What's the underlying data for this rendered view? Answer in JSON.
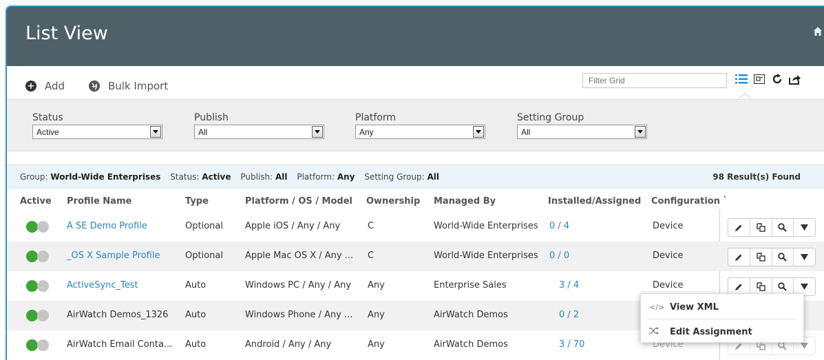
{
  "header": {
    "title": "List View",
    "home_icon": "home-icon"
  },
  "toolbar": {
    "add_label": "Add",
    "bulk_import_label": "Bulk Import",
    "filter_placeholder": "Filter Grid",
    "icons": [
      "list-view-icon",
      "card-view-icon",
      "refresh-icon",
      "export-icon"
    ]
  },
  "filters": {
    "status": {
      "label": "Status",
      "value": "Active"
    },
    "publish": {
      "label": "Publish",
      "value": "All"
    },
    "platform": {
      "label": "Platform",
      "value": "Any"
    },
    "setting_group": {
      "label": "Setting Group",
      "value": "All"
    }
  },
  "summary": {
    "group_label": "Group:",
    "group_value": "World-Wide Enterprises",
    "status_label": "Status:",
    "status_value": "Active",
    "publish_label": "Publish:",
    "publish_value": "All",
    "platform_label": "Platform:",
    "platform_value": "Any",
    "setting_group_label": "Setting Group:",
    "setting_group_value": "All",
    "results": "98 Result(s) Found"
  },
  "table": {
    "columns": {
      "active": "Active",
      "profile_name": "Profile Name",
      "type": "Type",
      "platform": "Platform / OS / Model",
      "ownership": "Ownership",
      "managed_by": "Managed By",
      "installed": "Installed/Assigned",
      "configuration": "Configuration `"
    },
    "rows": [
      {
        "name": "A SE Demo Profile",
        "name_link": true,
        "type": "Optional",
        "platform": "Apple iOS / Any / Any",
        "ownership": "C",
        "managed_by": "World-Wide Enterprises",
        "installed": "0 / 4",
        "configuration": "Device"
      },
      {
        "name": "_OS X Sample Profile",
        "name_link": true,
        "type": "Optional",
        "platform": "Apple Mac OS X / Any ...",
        "ownership": "C",
        "managed_by": "World-Wide Enterprises",
        "installed": "0 / 0",
        "configuration": "Device"
      },
      {
        "name": "ActiveSync_Test",
        "name_link": true,
        "type": "Auto",
        "platform": "Windows PC / Any / Any",
        "ownership": "Any",
        "managed_by": "Enterprise Sales",
        "installed": "3 / 4",
        "configuration": "Device"
      },
      {
        "name": "AirWatch Demos_1326",
        "name_link": false,
        "type": "Auto",
        "platform": "Windows Phone / Any ...",
        "ownership": "Any",
        "managed_by": "AirWatch Demos",
        "installed": "0 / 2",
        "configuration": ""
      },
      {
        "name": "AirWatch Email Conta...",
        "name_link": false,
        "type": "Auto",
        "platform": "Android / Any / Any",
        "ownership": "Any",
        "managed_by": "AirWatch Demos",
        "installed": "3 / 70",
        "configuration": "Device"
      }
    ]
  },
  "context_menu": {
    "items": [
      {
        "icon": "code-icon",
        "label": "View XML"
      },
      {
        "icon": "shuffle-icon",
        "label": "Edit Assignment"
      }
    ]
  },
  "colors": {
    "header_bg": "#4e6068",
    "accent": "#2a85c4",
    "active_toggle": "#3fa535",
    "summary_bg": "#ebf5f9"
  }
}
